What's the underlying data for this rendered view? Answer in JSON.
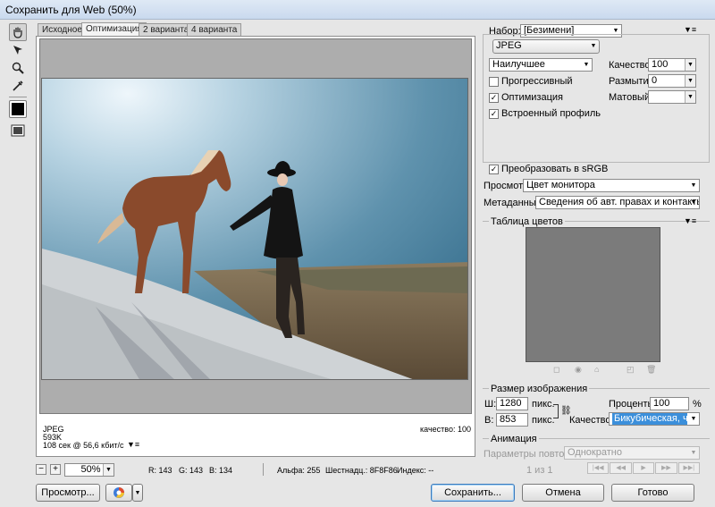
{
  "window": {
    "title": "Сохранить для Web (50%)"
  },
  "tabs": [
    "Исходное",
    "Оптимизация",
    "2 варианта",
    "4 варианта"
  ],
  "canvas": {
    "format": "JPEG",
    "size": "593K",
    "time": "108 сек @ 56,6 кбит/с",
    "quality": "качество: 100"
  },
  "status": {
    "zoom": "50%",
    "r": "R: 143",
    "g": "G: 143",
    "b": "B: 134",
    "alpha": "Альфа: 255",
    "hex": "Шестнадц.: 8F8F86",
    "index": "Индекс: --"
  },
  "footer": {
    "preview": "Просмотр...",
    "save": "Сохранить...",
    "cancel": "Отмена",
    "done": "Готово"
  },
  "settings": {
    "preset_label": "Набор:",
    "preset": "[Безимени]",
    "format": "JPEG",
    "quality_preset": "Наилучшее",
    "quality_label": "Качество:",
    "quality": "100",
    "progressive": "Прогрессивный",
    "blur_label": "Размытие:",
    "blur": "0",
    "optimized": "Оптимизация",
    "matte_label": "Матовый:",
    "matte": "",
    "embed_profile": "Встроенный профиль",
    "convert_srgb": "Преобразовать в sRGB",
    "preview_label": "Просмотр:",
    "preview": "Цвет монитора",
    "metadata_label": "Метаданные:",
    "metadata": "Сведения об авт. правах и контакты"
  },
  "color_table": {
    "title": "Таблица цветов"
  },
  "image_size": {
    "title": "Размер изображения",
    "w_label": "Ш:",
    "w": "1280",
    "w_unit": "пикс.",
    "h_label": "В:",
    "h": "853",
    "h_unit": "пикс.",
    "percent_label": "Проценты:",
    "percent": "100",
    "percent_unit": "%",
    "quality_label": "Качество:",
    "quality": "Бикубическая, че..."
  },
  "animation": {
    "title": "Анимация",
    "loop_label": "Параметры повторов:",
    "loop": "Однократно",
    "frame": "1 из 1"
  }
}
